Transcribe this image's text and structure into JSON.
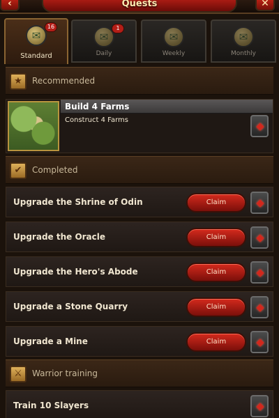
{
  "window": {
    "title": "Quests",
    "back_icon": "back-arrow-icon",
    "close_icon": "close-icon",
    "close_glyph": "✕",
    "back_glyph": "‹"
  },
  "tabs": [
    {
      "label": "Standard",
      "badge": "16",
      "active": true
    },
    {
      "label": "Daily",
      "badge": "1",
      "active": false
    },
    {
      "label": "Weekly",
      "badge": "",
      "active": false
    },
    {
      "label": "Monthly",
      "badge": "",
      "active": false
    }
  ],
  "sections": {
    "recommended": {
      "title": "Recommended"
    },
    "completed": {
      "title": "Completed"
    },
    "warrior": {
      "title": "Warrior training"
    }
  },
  "featured": {
    "title": "Build 4 Farms",
    "description": "Construct 4 Farms"
  },
  "completed_quests": [
    {
      "title": "Upgrade the Shrine of Odin",
      "action": "Claim"
    },
    {
      "title": "Upgrade the Oracle",
      "action": "Claim"
    },
    {
      "title": "Upgrade the Hero's Abode",
      "action": "Claim"
    },
    {
      "title": "Upgrade a Stone Quarry",
      "action": "Claim"
    },
    {
      "title": "Upgrade a Mine",
      "action": "Claim"
    }
  ],
  "warrior_quests": [
    {
      "title": "Train 10 Slayers"
    }
  ],
  "colors": {
    "accent_red": "#c92517",
    "gold": "#b8943e",
    "panel": "#2d2420"
  }
}
